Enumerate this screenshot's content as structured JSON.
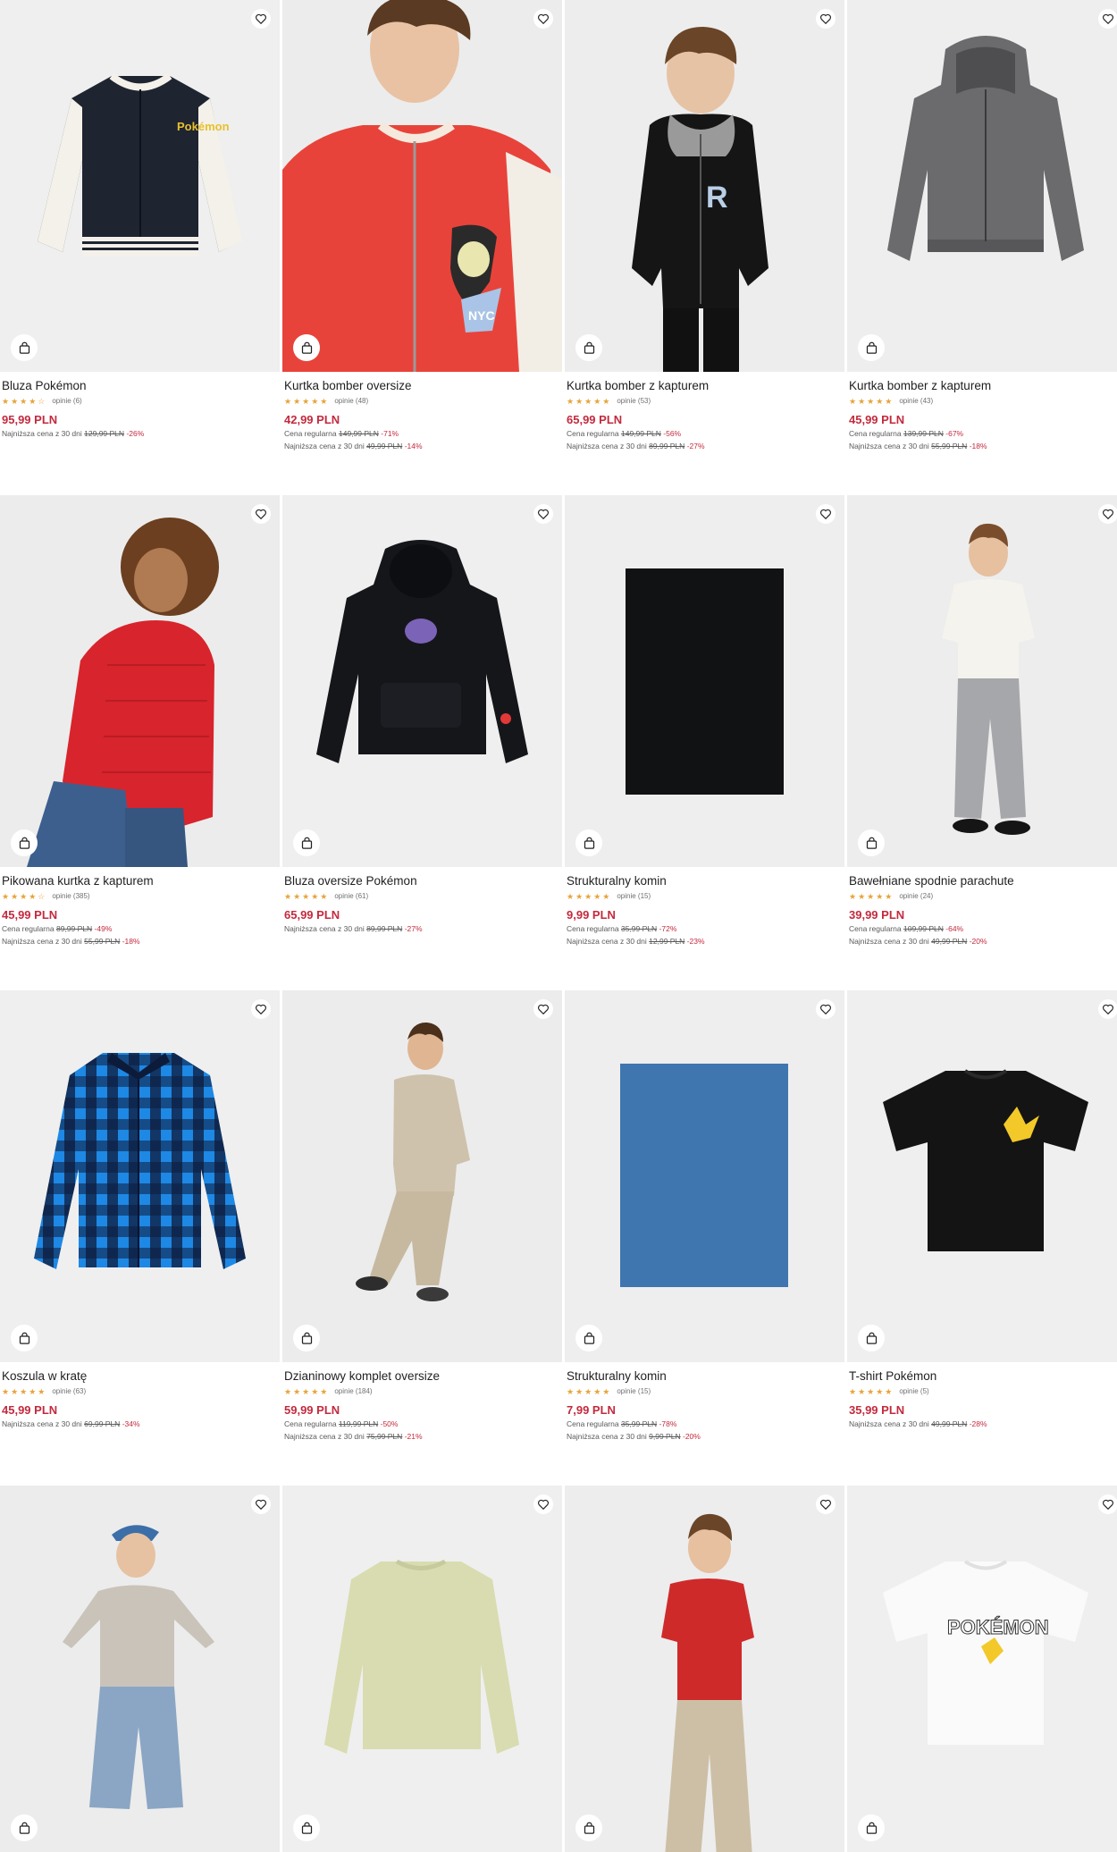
{
  "ui": {
    "wishlist_icon": "heart-outline-icon",
    "bag_icon": "shopping-bag-icon",
    "price_color": "#c32a3e",
    "star_color": "#e6a43a"
  },
  "products": [
    {
      "name": "Bluza Pokémon",
      "stars": "★★★★☆",
      "reviews": "opinie (6)",
      "price": "95,99 PLN",
      "regular_label": "",
      "regular_price": "",
      "regular_disc": "",
      "lowest_label": "Najniższa cena z 30 dni",
      "lowest_price": "129,99 PLN",
      "lowest_disc": "-26%"
    },
    {
      "name": "Kurtka bomber oversize",
      "stars": "★★★★★",
      "reviews": "opinie (48)",
      "price": "42,99 PLN",
      "regular_label": "Cena regularna",
      "regular_price": "149,99 PLN",
      "regular_disc": "-71%",
      "lowest_label": "Najniższa cena z 30 dni",
      "lowest_price": "49,99 PLN",
      "lowest_disc": "-14%"
    },
    {
      "name": "Kurtka bomber z kapturem",
      "stars": "★★★★★",
      "reviews": "opinie (53)",
      "price": "65,99 PLN",
      "regular_label": "Cena regularna",
      "regular_price": "149,99 PLN",
      "regular_disc": "-56%",
      "lowest_label": "Najniższa cena z 30 dni",
      "lowest_price": "89,99 PLN",
      "lowest_disc": "-27%"
    },
    {
      "name": "Kurtka bomber z kapturem",
      "stars": "★★★★★",
      "reviews": "opinie (43)",
      "price": "45,99 PLN",
      "regular_label": "Cena regularna",
      "regular_price": "139,99 PLN",
      "regular_disc": "-67%",
      "lowest_label": "Najniższa cena z 30 dni",
      "lowest_price": "55,99 PLN",
      "lowest_disc": "-18%"
    },
    {
      "name": "Pikowana kurtka z kapturem",
      "stars": "★★★★☆",
      "reviews": "opinie (385)",
      "price": "45,99 PLN",
      "regular_label": "Cena regularna",
      "regular_price": "89,99 PLN",
      "regular_disc": "-49%",
      "lowest_label": "Najniższa cena z 30 dni",
      "lowest_price": "55,99 PLN",
      "lowest_disc": "-18%"
    },
    {
      "name": "Bluza oversize Pokémon",
      "stars": "★★★★★",
      "reviews": "opinie (61)",
      "price": "65,99 PLN",
      "regular_label": "",
      "regular_price": "",
      "regular_disc": "",
      "lowest_label": "Najniższa cena z 30 dni",
      "lowest_price": "89,99 PLN",
      "lowest_disc": "-27%"
    },
    {
      "name": "Strukturalny komin",
      "stars": "★★★★★",
      "reviews": "opinie (15)",
      "price": "9,99 PLN",
      "regular_label": "Cena regularna",
      "regular_price": "35,99 PLN",
      "regular_disc": "-72%",
      "lowest_label": "Najniższa cena z 30 dni",
      "lowest_price": "12,99 PLN",
      "lowest_disc": "-23%"
    },
    {
      "name": "Bawełniane spodnie parachute",
      "stars": "★★★★★",
      "reviews": "opinie (24)",
      "price": "39,99 PLN",
      "regular_label": "Cena regularna",
      "regular_price": "109,99 PLN",
      "regular_disc": "-64%",
      "lowest_label": "Najniższa cena z 30 dni",
      "lowest_price": "49,99 PLN",
      "lowest_disc": "-20%"
    },
    {
      "name": "Koszula w kratę",
      "stars": "★★★★★",
      "reviews": "opinie (63)",
      "price": "45,99 PLN",
      "regular_label": "",
      "regular_price": "",
      "regular_disc": "",
      "lowest_label": "Najniższa cena z 30 dni",
      "lowest_price": "69,99 PLN",
      "lowest_disc": "-34%"
    },
    {
      "name": "Dzianinowy komplet oversize",
      "stars": "★★★★★",
      "reviews": "opinie (184)",
      "price": "59,99 PLN",
      "regular_label": "Cena regularna",
      "regular_price": "119,99 PLN",
      "regular_disc": "-50%",
      "lowest_label": "Najniższa cena z 30 dni",
      "lowest_price": "75,99 PLN",
      "lowest_disc": "-21%"
    },
    {
      "name": "Strukturalny komin",
      "stars": "★★★★★",
      "reviews": "opinie (15)",
      "price": "7,99 PLN",
      "regular_label": "Cena regularna",
      "regular_price": "35,99 PLN",
      "regular_disc": "-78%",
      "lowest_label": "Najniższa cena z 30 dni",
      "lowest_price": "9,99 PLN",
      "lowest_disc": "-20%"
    },
    {
      "name": "T-shirt Pokémon",
      "stars": "★★★★★",
      "reviews": "opinie (5)",
      "price": "35,99 PLN",
      "regular_label": "",
      "regular_price": "",
      "regular_disc": "",
      "lowest_label": "Najniższa cena z 30 dni",
      "lowest_price": "49,99 PLN",
      "lowest_disc": "-28%"
    },
    {
      "name": "",
      "stars": "",
      "reviews": "",
      "price": "",
      "regular_label": "",
      "regular_price": "",
      "regular_disc": "",
      "lowest_label": "",
      "lowest_price": "",
      "lowest_disc": ""
    },
    {
      "name": "",
      "stars": "",
      "reviews": "",
      "price": "",
      "regular_label": "",
      "regular_price": "",
      "regular_disc": "",
      "lowest_label": "",
      "lowest_price": "",
      "lowest_disc": ""
    },
    {
      "name": "",
      "stars": "",
      "reviews": "",
      "price": "",
      "regular_label": "",
      "regular_price": "",
      "regular_disc": "",
      "lowest_label": "",
      "lowest_price": "",
      "lowest_disc": ""
    },
    {
      "name": "",
      "stars": "",
      "reviews": "",
      "price": "",
      "regular_label": "",
      "regular_price": "",
      "regular_disc": "",
      "lowest_label": "",
      "lowest_price": "",
      "lowest_disc": ""
    }
  ],
  "art": {
    "pokemon_logo": "Pokémon",
    "tshirt_logo": "POKÉMON",
    "nyc_patch": "NYC",
    "r_logo": "R"
  }
}
